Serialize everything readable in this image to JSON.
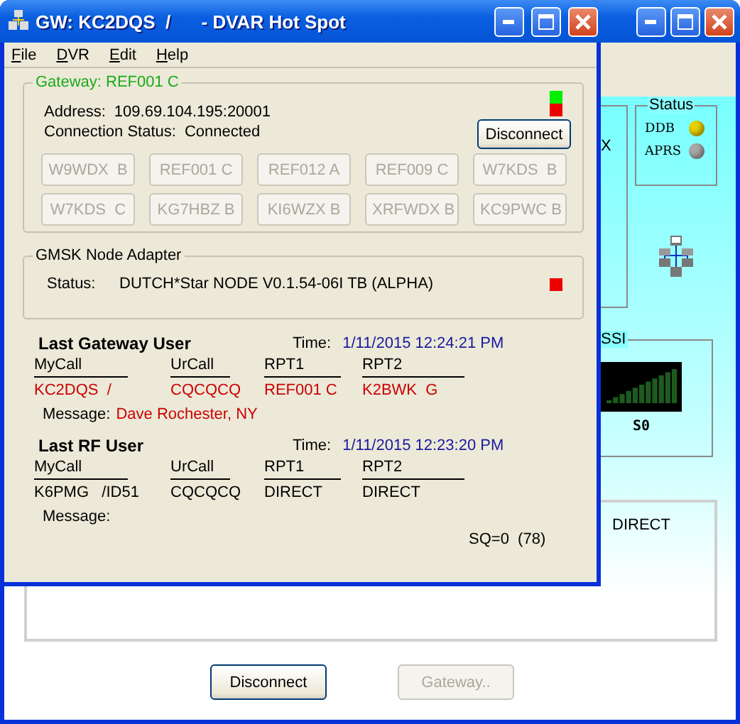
{
  "back_window": {
    "fragment_text": "X",
    "status_group": {
      "title": "Status",
      "items": [
        {
          "label": "DDB",
          "color": "#e8d000"
        },
        {
          "label": "APRS",
          "color": "#a8a8a8"
        }
      ]
    },
    "rssi_group": {
      "title": "SSI",
      "reading": "S0"
    },
    "info_panel": {
      "text": "DIRECT"
    },
    "buttons": [
      {
        "label": "Disconnect",
        "disabled": false
      },
      {
        "label": "Gateway..",
        "disabled": true
      }
    ]
  },
  "window": {
    "title": "GW: KC2DQS  /      - DVAR Hot Spot"
  },
  "menu": [
    "File",
    "DVR",
    "Edit",
    "Help"
  ],
  "gateway": {
    "title": "Gateway: REF001 C",
    "address_label": "Address:",
    "address": "109.69.104.195:20001",
    "status_label": "Connection Status:",
    "status": "Connected",
    "indicators": [
      {
        "color": "#00ee00"
      },
      {
        "color": "#ee0000"
      }
    ],
    "disconnect": "Disconnect",
    "reflectors": [
      {
        "label": "W9WDX  B",
        "disabled": true
      },
      {
        "label": "REF001 C",
        "disabled": true
      },
      {
        "label": "REF012 A",
        "disabled": true
      },
      {
        "label": "REF009 C",
        "disabled": true
      },
      {
        "label": "W7KDS  B",
        "disabled": true
      },
      {
        "label": "W7KDS  C",
        "disabled": true
      },
      {
        "label": "KG7HBZ B",
        "disabled": true
      },
      {
        "label": "KI6WZX B",
        "disabled": true
      },
      {
        "label": "XRFWDX B",
        "disabled": true
      },
      {
        "label": "KC9PWC B",
        "disabled": true
      }
    ]
  },
  "node_adapter": {
    "title": "GMSK Node Adapter",
    "status_label": "Status:",
    "status": "DUTCH*Star NODE V0.1.54-06I TB (ALPHA)",
    "indicators": [
      {
        "color": "#ee0000"
      }
    ]
  },
  "users": [
    {
      "kind": "gateway",
      "title": "Last Gateway User",
      "time_label": "Time:",
      "time": "1/11/2015 12:24:21 PM",
      "columns": [
        "MyCall",
        "UrCall",
        "RPT1",
        "RPT2"
      ],
      "values": [
        "KC2DQS  /",
        "CQCQCQ",
        "REF001 C",
        "K2BWK  G"
      ],
      "message_label": "Message:",
      "message": "Dave Rochester, NY"
    },
    {
      "kind": "rf",
      "title": "Last RF User",
      "time_label": "Time:",
      "time": "1/11/2015 12:23:20 PM",
      "columns": [
        "MyCall",
        "UrCall",
        "RPT1",
        "RPT2"
      ],
      "values": [
        "K6PMG   /ID51",
        "CQCQCQ",
        "DIRECT",
        "DIRECT"
      ],
      "message_label": "Message:",
      "sq": "SQ=0  (78)"
    }
  ]
}
